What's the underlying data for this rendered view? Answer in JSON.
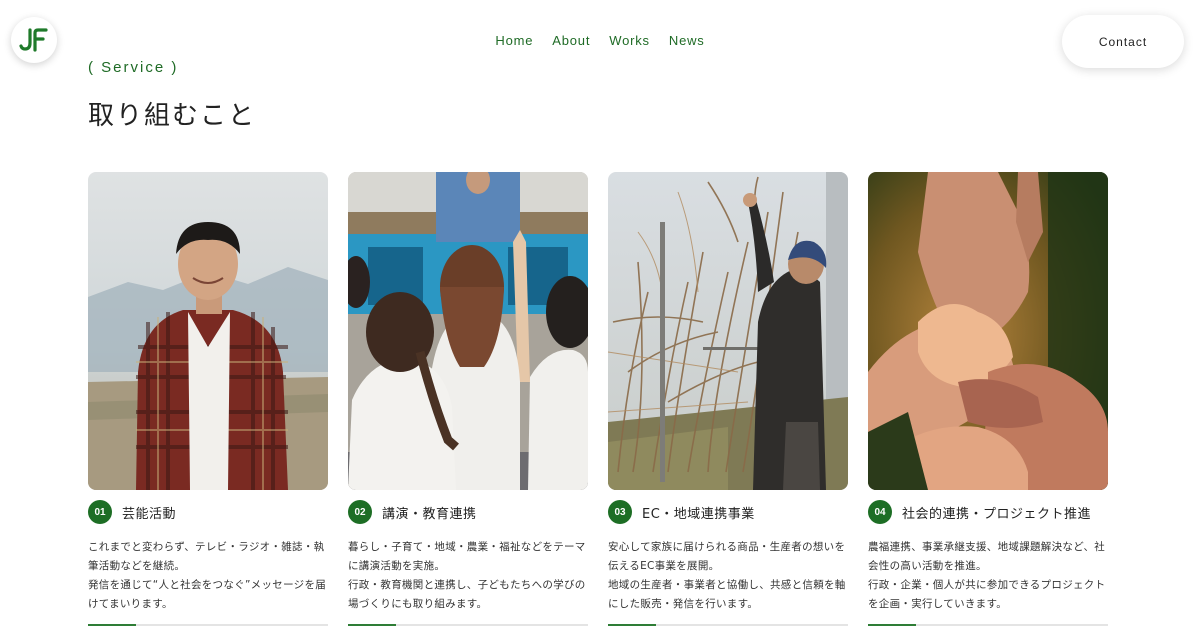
{
  "logo": {
    "text": "JF",
    "color": "#1f7a2a"
  },
  "nav": {
    "items": [
      "Home",
      "About",
      "Works",
      "News"
    ]
  },
  "contact": {
    "label": "Contact"
  },
  "section": {
    "eyebrow": "( Service )",
    "title": "取り組むこと"
  },
  "accent_color": "#1d6e25",
  "cards": [
    {
      "number": "01",
      "title": "芸能活動",
      "photo_icon": "man-in-plaid-shirt-photo",
      "body": [
        "これまでと変わらず、テレビ・ラジオ・雑誌・執",
        "筆活動などを継続。",
        "発信を通じて“人と社会をつなぐ”メッセージを届",
        "けてまいります。"
      ],
      "progress": 0.2
    },
    {
      "number": "02",
      "title": "講演・教育連携",
      "photo_icon": "children-in-classroom-photo",
      "body": [
        "暮らし・子育て・地域・農業・福祉などをテーマ",
        "に講演活動を実施。",
        "行政・教育機関と連携し、子どもたちへの学びの",
        "場づくりにも取り組みます。"
      ],
      "progress": 0.2
    },
    {
      "number": "03",
      "title": "EC・地域連携事業",
      "photo_icon": "vineyard-farmer-photo",
      "body": [
        "安心して家族に届けられる商品・生産者の想いを",
        "伝えるEC事業を展開。",
        "地域の生産者・事業者と協働し、共感と信頼を軸",
        "にした販売・発信を行います。"
      ],
      "progress": 0.2
    },
    {
      "number": "04",
      "title": "社会的連携・プロジェクト推進",
      "photo_icon": "joined-hands-photo",
      "body": [
        "農福連携、事業承継支援、地域課題解決など、社",
        "会性の高い活動を推進。",
        "行政・企業・個人が共に参加できるプロジェクト",
        "を企画・実行していきます。"
      ],
      "progress": 0.2
    }
  ]
}
